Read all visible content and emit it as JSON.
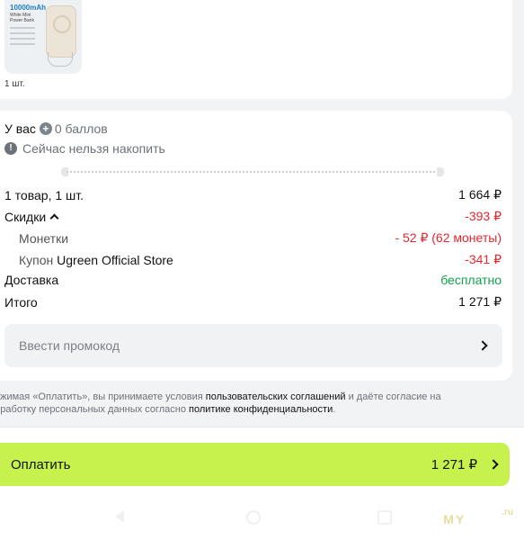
{
  "product": {
    "thumb_title": "10000mAh",
    "thumb_subtitle": "White Mini Power Bank",
    "quantity": "1 шт."
  },
  "points": {
    "prefix": "У вас",
    "value": "0 баллов",
    "notice": "Сейчас нельзя накопить"
  },
  "summary": {
    "items_label": "1 товар, 1 шт.",
    "items_price": "1 664 ₽",
    "discounts_label": "Скидки",
    "discounts_value": "-393 ₽",
    "coins_label": "Монетки",
    "coins_value": "- 52 ₽ (62 монеты)",
    "coupon_label": "Купон",
    "coupon_store": "Ugreen Official Store",
    "coupon_value": "-341 ₽",
    "delivery_label": "Доставка",
    "delivery_value": "бесплатно",
    "total_label": "Итого",
    "total_value": "1 271 ₽"
  },
  "promo": {
    "label": "Ввести промокод"
  },
  "terms": {
    "part1": "ажимая «Оплатить», вы принимаете условия ",
    "link1": "пользовательских соглашений",
    "part2": " и даёте согласие на",
    "part3": "бработку персональных данных согласно ",
    "link2": "политике конфиденциальности",
    "part4": "."
  },
  "pay": {
    "label": "Оплатить",
    "amount": "1 271 ₽"
  },
  "watermark": {
    "text": "MY",
    "suffix": ".ru"
  },
  "colors": {
    "accent": "#c7f14d",
    "discount": "#e8262f",
    "free": "#11a14a"
  }
}
